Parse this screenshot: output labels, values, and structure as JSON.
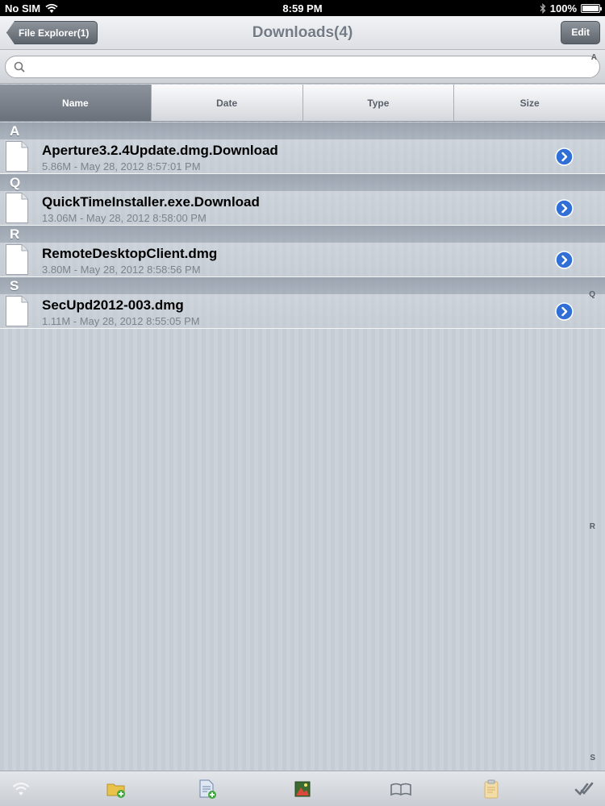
{
  "status_bar": {
    "carrier": "No SIM",
    "time": "8:59 PM",
    "battery": "100%"
  },
  "nav": {
    "back_label": "File Explorer(1)",
    "title": "Downloads(4)",
    "edit_label": "Edit"
  },
  "search": {
    "placeholder": "",
    "index_top": "A"
  },
  "sort_tabs": [
    "Name",
    "Date",
    "Type",
    "Size"
  ],
  "sort_active": "Name",
  "sections": [
    {
      "letter": "A",
      "files": [
        {
          "name": "Aperture3.2.4Update.dmg.Download",
          "meta": "5.86M - May 28, 2012 8:57:01 PM"
        }
      ]
    },
    {
      "letter": "Q",
      "files": [
        {
          "name": "QuickTimeInstaller.exe.Download",
          "meta": "13.06M - May 28, 2012 8:58:00 PM"
        }
      ]
    },
    {
      "letter": "R",
      "files": [
        {
          "name": "RemoteDesktopClient.dmg",
          "meta": "3.80M - May 28, 2012 8:58:56 PM"
        }
      ]
    },
    {
      "letter": "S",
      "files": [
        {
          "name": "SecUpd2012-003.dmg",
          "meta": "1.11M - May 28, 2012 8:55:05 PM"
        }
      ]
    }
  ],
  "side_index": [
    "Q",
    "R",
    "S"
  ],
  "toolbar_icons": [
    "wifi-icon",
    "new-folder-icon",
    "new-file-icon",
    "photos-icon",
    "bookmarks-icon",
    "clipboard-icon",
    "checkmark-icon"
  ],
  "colors": {
    "disclosure_blue": "#2f6fd6",
    "active_tab": "#6a717a",
    "background": "#c5ccd4"
  }
}
